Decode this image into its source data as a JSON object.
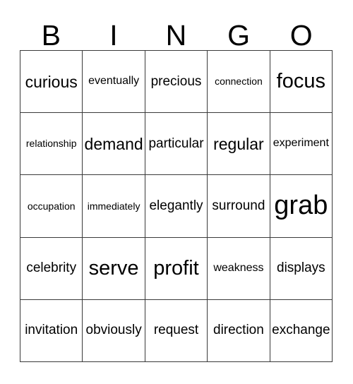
{
  "header": {
    "letters": [
      "B",
      "I",
      "N",
      "G",
      "O"
    ]
  },
  "grid": {
    "rows": [
      [
        {
          "word": "curious",
          "size": "fs-l"
        },
        {
          "word": "eventually",
          "size": "fs-s"
        },
        {
          "word": "precious",
          "size": "fs-m"
        },
        {
          "word": "connection",
          "size": "fs-xs"
        },
        {
          "word": "focus",
          "size": "fs-xl"
        }
      ],
      [
        {
          "word": "relationship",
          "size": "fs-xs"
        },
        {
          "word": "demand",
          "size": "fs-l"
        },
        {
          "word": "particular",
          "size": "fs-m"
        },
        {
          "word": "regular",
          "size": "fs-l"
        },
        {
          "word": "experiment",
          "size": "fs-s"
        }
      ],
      [
        {
          "word": "occupation",
          "size": "fs-xs"
        },
        {
          "word": "immediately",
          "size": "fs-xs"
        },
        {
          "word": "elegantly",
          "size": "fs-m"
        },
        {
          "word": "surround",
          "size": "fs-m"
        },
        {
          "word": "grab",
          "size": "fs-xxl"
        }
      ],
      [
        {
          "word": "celebrity",
          "size": "fs-m"
        },
        {
          "word": "serve",
          "size": "fs-xl"
        },
        {
          "word": "profit",
          "size": "fs-xl"
        },
        {
          "word": "weakness",
          "size": "fs-s"
        },
        {
          "word": "displays",
          "size": "fs-m"
        }
      ],
      [
        {
          "word": "invitation",
          "size": "fs-m"
        },
        {
          "word": "obviously",
          "size": "fs-m"
        },
        {
          "word": "request",
          "size": "fs-m"
        },
        {
          "word": "direction",
          "size": "fs-m"
        },
        {
          "word": "exchange",
          "size": "fs-m"
        }
      ]
    ]
  },
  "colors": {
    "background": "#ffffff",
    "text": "#000000",
    "grid_line": "#3a3a3a"
  }
}
